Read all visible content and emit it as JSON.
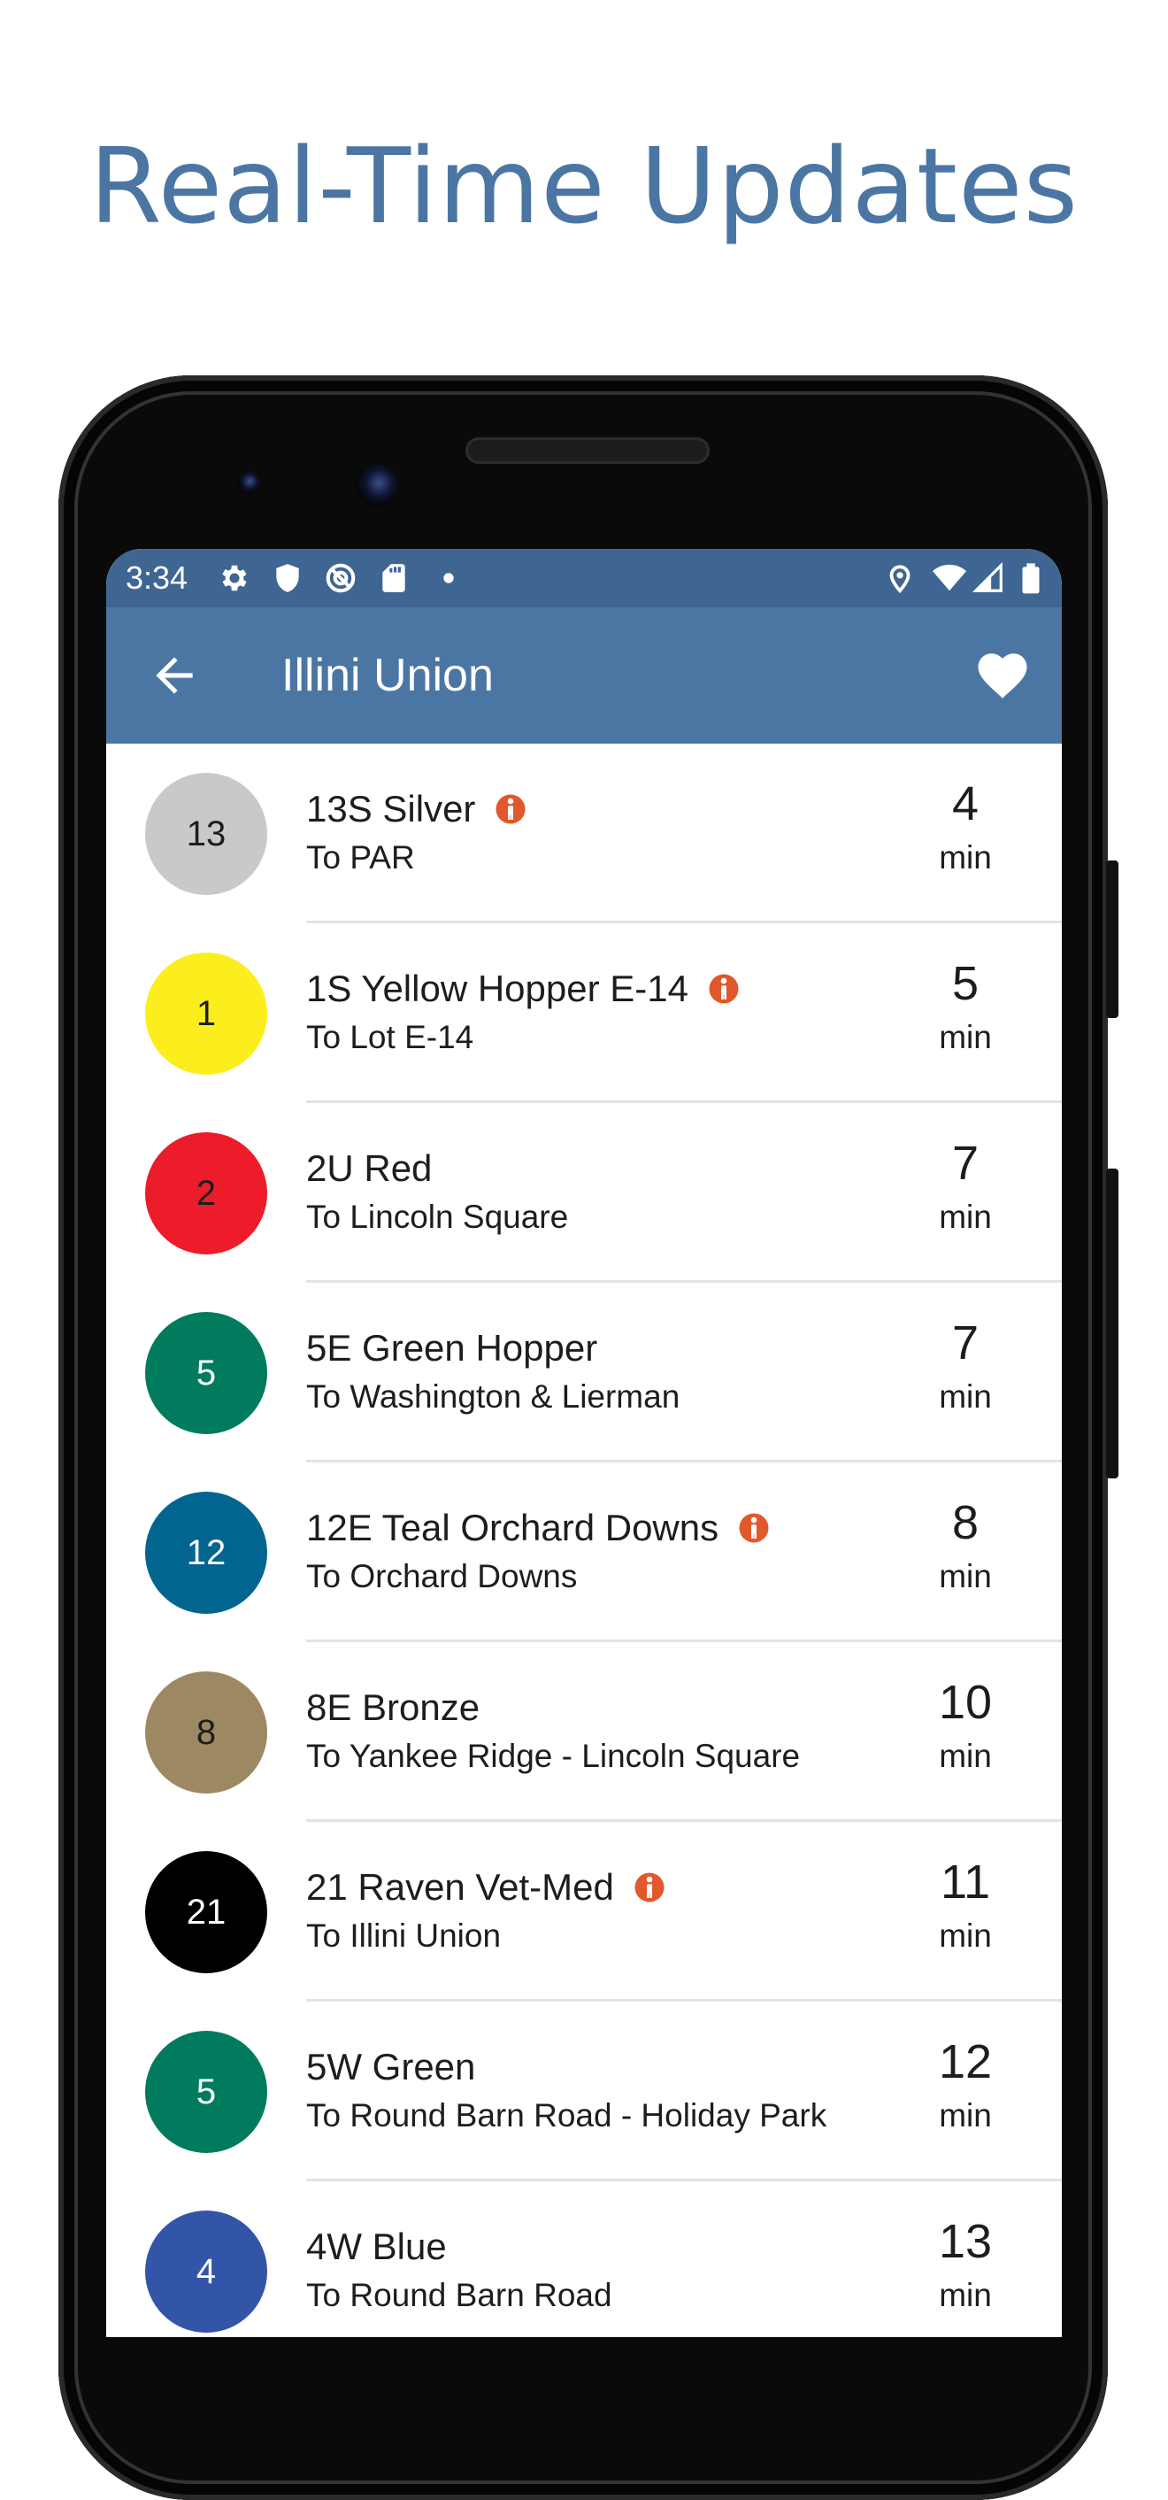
{
  "promo": {
    "headline": "Real-Time Updates"
  },
  "status_bar": {
    "time": "3:34",
    "left_icons": [
      "gear-icon",
      "shield-icon",
      "sync-off-icon",
      "sd-card-icon",
      "dot-icon"
    ],
    "right_icons": [
      "location-icon",
      "wifi-icon",
      "signal-icon",
      "battery-icon"
    ]
  },
  "app_bar": {
    "title": "Illini Union",
    "back_icon": "arrow-back-icon",
    "favorite_icon": "heart-icon"
  },
  "colors": {
    "primary": "#4b76a4",
    "status_bar": "#3f6592",
    "accessible_badge": "#e0582b"
  },
  "departures": [
    {
      "number": "13",
      "color": "#c9c9c9",
      "text_color": "#1d1d1d",
      "route": "13S Silver",
      "accessible": true,
      "destination": "To PAR",
      "minutes": "4",
      "unit": "min"
    },
    {
      "number": "1",
      "color": "#fcee1c",
      "text_color": "#1d1d1d",
      "route": "1S Yellow Hopper E-14",
      "accessible": true,
      "destination": "To Lot E-14",
      "minutes": "5",
      "unit": "min"
    },
    {
      "number": "2",
      "color": "#ec1c2a",
      "text_color": "#1d1d1d",
      "route": "2U Red",
      "accessible": false,
      "destination": "To Lincoln Square",
      "minutes": "7",
      "unit": "min"
    },
    {
      "number": "5",
      "color": "#017b5d",
      "text_color": "#ffffff",
      "route": "5E Green Hopper",
      "accessible": false,
      "destination": "To Washington & Lierman",
      "minutes": "7",
      "unit": "min"
    },
    {
      "number": "12",
      "color": "#02658f",
      "text_color": "#ffffff",
      "route": "12E Teal Orchard Downs",
      "accessible": true,
      "destination": "To Orchard Downs",
      "minutes": "8",
      "unit": "min"
    },
    {
      "number": "8",
      "color": "#9d8864",
      "text_color": "#1d1d1d",
      "route": "8E Bronze",
      "accessible": false,
      "destination": "To Yankee Ridge - Lincoln Square",
      "minutes": "10",
      "unit": "min"
    },
    {
      "number": "21",
      "color": "#000000",
      "text_color": "#ffffff",
      "route": "21 Raven Vet-Med",
      "accessible": true,
      "destination": "To Illini Union",
      "minutes": "11",
      "unit": "min"
    },
    {
      "number": "5",
      "color": "#017b5d",
      "text_color": "#ffffff",
      "route": "5W Green",
      "accessible": false,
      "destination": "To Round Barn Road - Holiday Park",
      "minutes": "12",
      "unit": "min"
    },
    {
      "number": "4",
      "color": "#3355a8",
      "text_color": "#ffffff",
      "route": "4W Blue",
      "accessible": false,
      "destination": "To Round Barn Road",
      "minutes": "13",
      "unit": "min"
    }
  ]
}
